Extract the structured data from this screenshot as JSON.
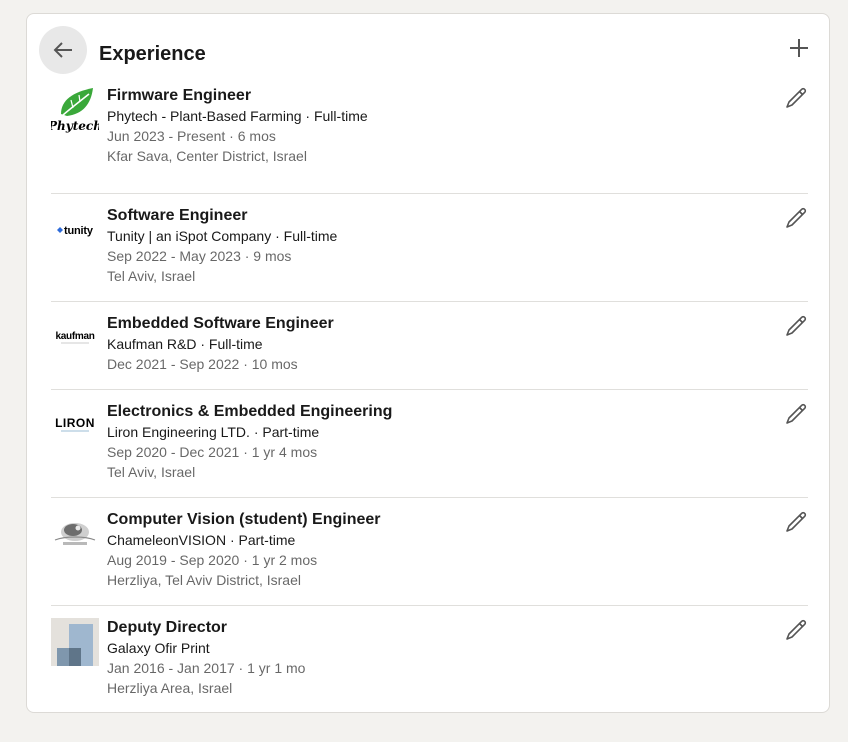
{
  "header": {
    "title": "Experience",
    "back_icon": "arrow-left-icon",
    "add_icon": "plus-icon"
  },
  "experiences": [
    {
      "title": "Firmware Engineer",
      "company": "Phytech - Plant-Based Farming · Full-time",
      "dates": "Jun 2023 - Present · 6 mos",
      "location": "Kfar Sava, Center District, Israel",
      "logo_text": "Phytech",
      "logo_color": "#3aa83a"
    },
    {
      "title": "Software Engineer",
      "company": "Tunity | an iSpot Company · Full-time",
      "dates": "Sep 2022 - May 2023 · 9 mos",
      "location": "Tel Aviv, Israel",
      "logo_text": "tunity",
      "logo_color": "#1d2a55"
    },
    {
      "title": "Embedded Software Engineer",
      "company": "Kaufman R&D · Full-time",
      "dates": "Dec 2021 - Sep 2022 · 10 mos",
      "location": "",
      "logo_text": "kaufman",
      "logo_color": "#222222"
    },
    {
      "title": "Electronics & Embedded Engineering",
      "company": "Liron Engineering LTD. · Part-time",
      "dates": "Sep 2020 - Dec 2021 · 1 yr 4 mos",
      "location": "Tel Aviv, Israel",
      "logo_text": "LIRON",
      "logo_color": "#2a7fb8"
    },
    {
      "title": "Computer Vision (student) Engineer",
      "company": "ChameleonVISION · Part-time",
      "dates": "Aug 2019 - Sep 2020 · 1 yr 2 mos",
      "location": "Herzliya, Tel Aviv District, Israel",
      "logo_text": "",
      "logo_color": "#888888"
    },
    {
      "title": "Deputy Director",
      "company": "Galaxy Ofir Print",
      "dates": "Jan 2016 - Jan 2017 · 1 yr 1 mo",
      "location": "Herzliya Area, Israel",
      "logo_text": "",
      "logo_color": "#9bb5cf"
    }
  ],
  "edit_icon": "pencil-icon"
}
